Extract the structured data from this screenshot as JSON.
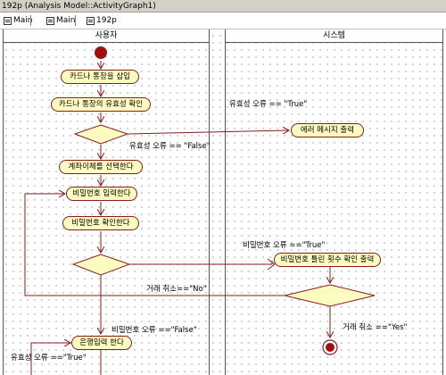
{
  "window": {
    "title": "192p (Analysis Model::ActivityGraph1)"
  },
  "tabs": [
    {
      "label": "Main",
      "icon": "diagram-icon"
    },
    {
      "label": "Main",
      "icon": "diagram-icon"
    },
    {
      "label": "192p",
      "icon": "diagram-icon"
    }
  ],
  "lanes": {
    "user": "사용자",
    "system": "시스템"
  },
  "activities": {
    "insert_card": "카드나 통장을 삽입",
    "validate_card": "카드나 통장의 유효성 확인",
    "error_message": "에러 메시지 출력",
    "select_transfer": "계좌이체를 선택한다",
    "enter_pin": "비밀번호 입력한다",
    "confirm_pin": "비밀번호 확인한다",
    "wrong_count": "비밀번호 틀린 횟수 확인 출력",
    "bank_input": "은행입력 한다"
  },
  "guards": {
    "valid_true": "유효성 오류 == \"True\"",
    "valid_false": "유효성 오류 == \"False\"",
    "pin_true": "비밀번호 오류 ==\"True\"",
    "cancel_no": "거래 취소==\"No\"",
    "cancel_yes": "거래 취소 ==\"Yes\"",
    "pin_false": "비밀번호 오류 ==\"False\"",
    "valid_true_2": "유효성 오류 ==\"True\""
  },
  "colors": {
    "activity_fill": "#fdfcc0",
    "activity_border": "#8a1c1c",
    "flow": "#8a1c1c",
    "start": "#a01010"
  }
}
